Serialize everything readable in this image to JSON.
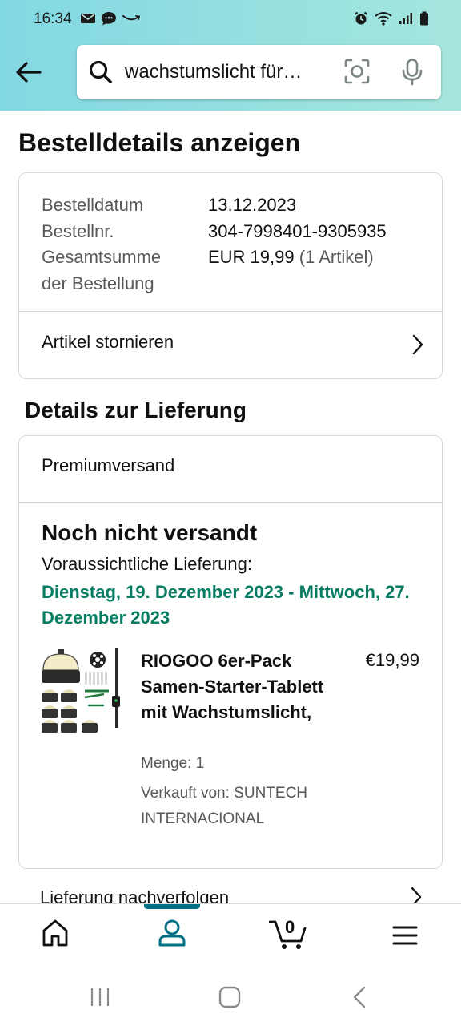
{
  "status_bar": {
    "time": "16:34",
    "left_icons": [
      "mail-icon",
      "chat-bubble-icon",
      "amazon-smile-icon"
    ],
    "right_icons": [
      "alarm-icon",
      "wifi-icon",
      "signal-icon",
      "battery-icon"
    ]
  },
  "search": {
    "value": "wachstumslicht für…",
    "icons": [
      "back-arrow-icon",
      "search-icon",
      "camera-scan-icon",
      "microphone-icon"
    ]
  },
  "page": {
    "title": "Bestelldetails anzeigen"
  },
  "order": {
    "date_label": "Bestelldatum",
    "date_value": "13.12.2023",
    "number_label": "Bestellnr.",
    "number_value": "304-7998401-9305935",
    "total_label_line1": "Gesamtsumme",
    "total_label_line2": "der Bestellung",
    "total_value": "EUR 19,99",
    "total_items": "(1 Artikel)",
    "cancel_label": "Artikel stornieren"
  },
  "delivery": {
    "section_title": "Details zur Lieferung",
    "shipping_type": "Premiumversand",
    "status": "Noch nicht versandt",
    "estimate_label": "Voraussichtliche Lieferung:",
    "estimate_date": "Dienstag, 19. Dezember 2023 - Mittwoch, 27. Dezember 2023",
    "track_label": "Lieferung nachverfolgen"
  },
  "product": {
    "title": "RIOGOO 6er-Pack Samen-Starter-Tablett mit Wachstumslicht,",
    "price": "€19,99",
    "quantity": "Menge: 1",
    "seller": "Verkauft von: SUNTECH INTERNACIONAL"
  },
  "bottom_nav": {
    "cart_count": "0",
    "items": [
      "home-icon",
      "account-icon",
      "cart-icon",
      "menu-icon"
    ],
    "active": "account-icon"
  },
  "colors": {
    "header_start": "#82d8e3",
    "header_end": "#a5e6de",
    "delivery_green": "#067d62",
    "active_teal": "#007185",
    "muted_text": "#565959"
  }
}
